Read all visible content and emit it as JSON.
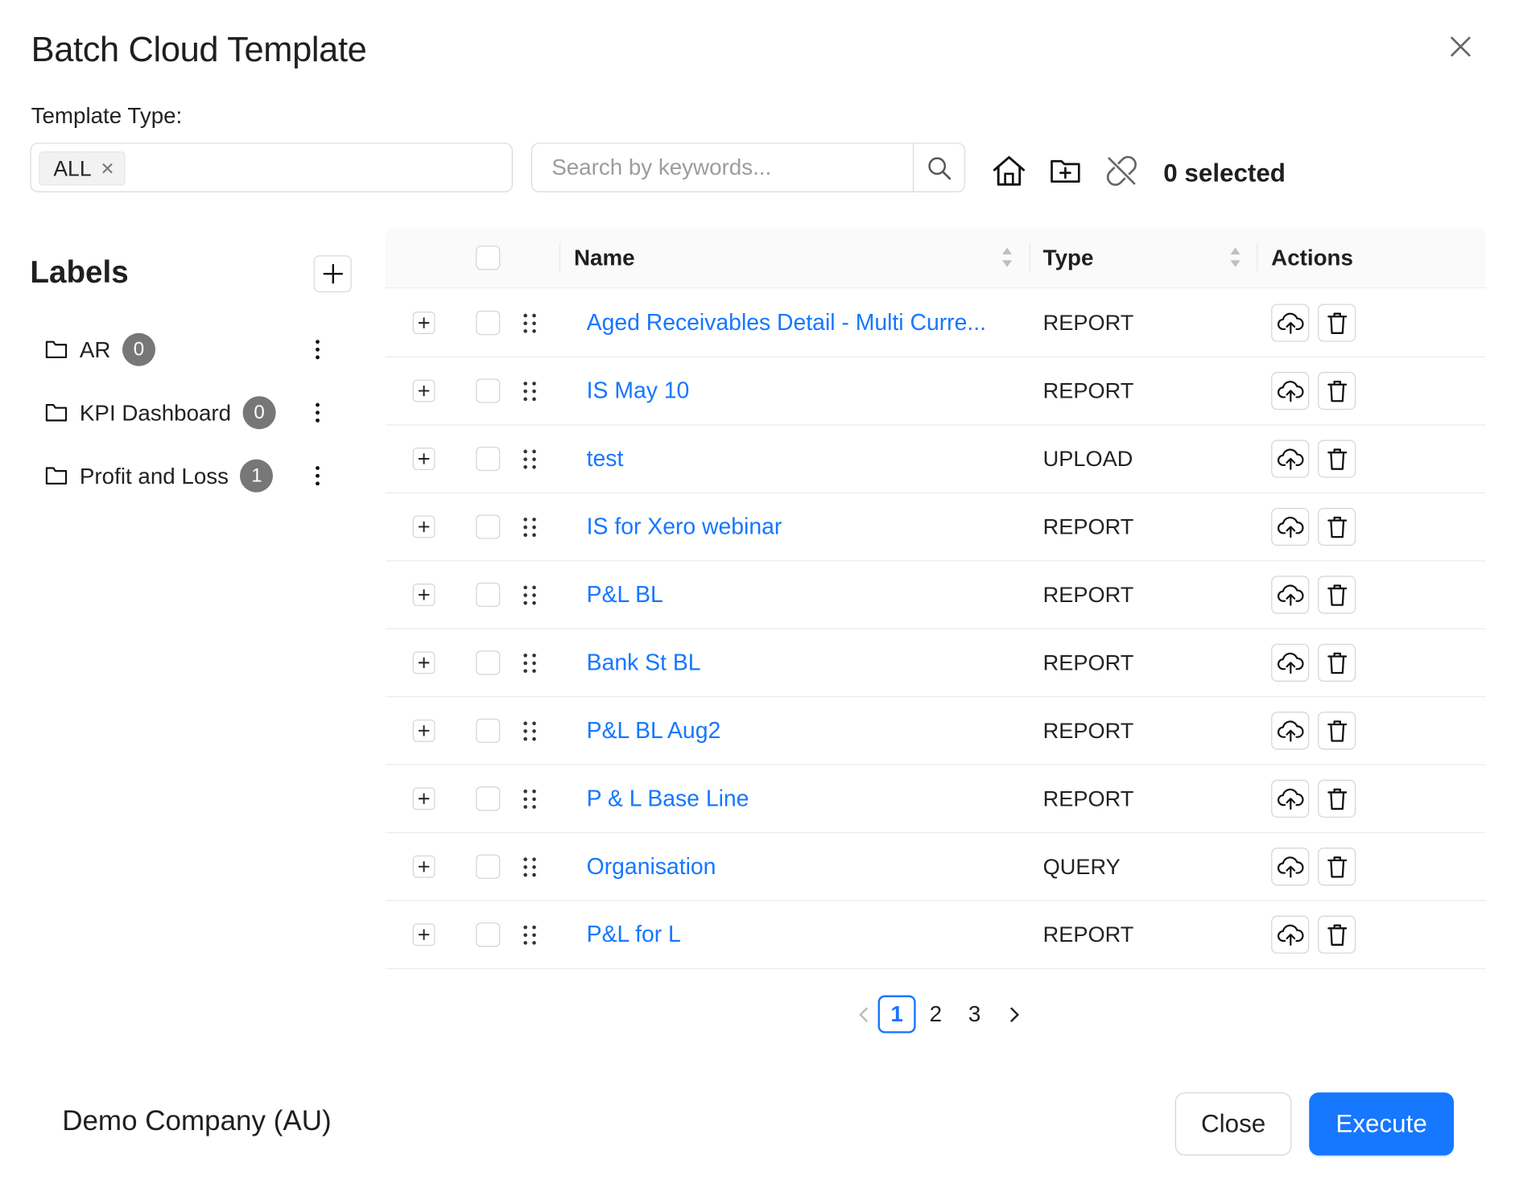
{
  "dialog": {
    "title": "Batch Cloud Template"
  },
  "filter": {
    "label": "Template Type:",
    "tags": [
      "ALL"
    ]
  },
  "search": {
    "placeholder": "Search by keywords..."
  },
  "toolbar": {
    "selected_text": "0 selected"
  },
  "labels": {
    "title": "Labels",
    "items": [
      {
        "name": "AR",
        "count": "0"
      },
      {
        "name": "KPI Dashboard",
        "count": "0"
      },
      {
        "name": "Profit and Loss",
        "count": "1"
      }
    ]
  },
  "table": {
    "headers": {
      "name": "Name",
      "type": "Type",
      "actions": "Actions"
    },
    "rows": [
      {
        "name": "Aged Receivables Detail - Multi Curre...",
        "type": "REPORT"
      },
      {
        "name": "IS May 10",
        "type": "REPORT"
      },
      {
        "name": "test",
        "type": "UPLOAD"
      },
      {
        "name": "IS for Xero webinar",
        "type": "REPORT"
      },
      {
        "name": "P&L BL",
        "type": "REPORT"
      },
      {
        "name": "Bank St BL",
        "type": "REPORT"
      },
      {
        "name": "P&L BL Aug2",
        "type": "REPORT"
      },
      {
        "name": "P & L Base Line",
        "type": "REPORT"
      },
      {
        "name": "Organisation",
        "type": "QUERY"
      },
      {
        "name": "P&L for L",
        "type": "REPORT"
      }
    ]
  },
  "pagination": {
    "pages": [
      "1",
      "2",
      "3"
    ],
    "current": "1"
  },
  "footer": {
    "company": "Demo Company (AU)",
    "close_label": "Close",
    "execute_label": "Execute"
  },
  "colors": {
    "accent": "#1677ff",
    "badge": "#777777"
  },
  "icons": [
    "close-icon",
    "search-icon",
    "home-icon",
    "folder-add-icon",
    "unlink-icon",
    "plus-icon",
    "folder-icon",
    "more-vertical-icon",
    "sort-icon",
    "drag-handle-icon",
    "cloud-upload-icon",
    "trash-icon",
    "chevron-left-icon",
    "chevron-right-icon"
  ]
}
